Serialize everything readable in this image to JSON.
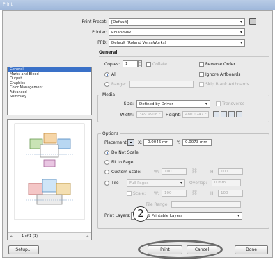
{
  "window": {
    "title": "Print"
  },
  "top": {
    "preset_label": "Print Preset:",
    "preset_value": "[Default]",
    "printer_label": "Printer:",
    "printer_value": "RolandVW",
    "ppd_label": "PPD:",
    "ppd_value": "Default (Roland VersaWorks)"
  },
  "sidebar": {
    "items": [
      "General",
      "Marks and Bleed",
      "Output",
      "Graphics",
      "Color Management",
      "Advanced",
      "Summary"
    ],
    "selected": "General"
  },
  "general": {
    "heading": "General",
    "copies_label": "Copies:",
    "copies_value": "1",
    "collate": "Collate",
    "reverse_order": "Reverse Order",
    "all": "All",
    "ignore_artboards": "Ignore Artboards",
    "range": "Range:",
    "skip_blank": "Skip Blank Artboards"
  },
  "media": {
    "heading": "Media",
    "size_label": "Size:",
    "size_value": "Defined by Driver",
    "transverse": "Transverse",
    "width_label": "Width:",
    "width_value": "349.9908 r",
    "height_label": "Height:",
    "height_value": "480.0247 r"
  },
  "options": {
    "heading": "Options",
    "placement_label": "Placement:",
    "x_label": "X:",
    "x_value": "-0.0046 mr",
    "y_label": "Y:",
    "y_value": "0.0073 mm",
    "do_not_scale": "Do Not Scale",
    "fit_to_page": "Fit to Page",
    "custom_scale": "Custom Scale:",
    "w_label": "W:",
    "w_value": "100",
    "h_label": "H:",
    "h_value": "100",
    "tile": "Tile",
    "tile_value": "Full Pages",
    "overlap_label": "Overlap:",
    "overlap_value": "0 mm",
    "scale_label": "Scale:",
    "scale_w_label": "W:",
    "scale_w_value": "100",
    "scale_h_label": "H:",
    "scale_h_value": "100",
    "tile_range_label": "Tile Range:",
    "print_layers_label": "Print Layers:",
    "print_layers_value": "Visible & Printable Layers"
  },
  "pager": {
    "text": "1 of 1 (1)"
  },
  "buttons": {
    "setup": "Setup...",
    "print": "Print",
    "cancel": "Cancel",
    "done": "Done"
  },
  "annotation": {
    "number": "2"
  }
}
